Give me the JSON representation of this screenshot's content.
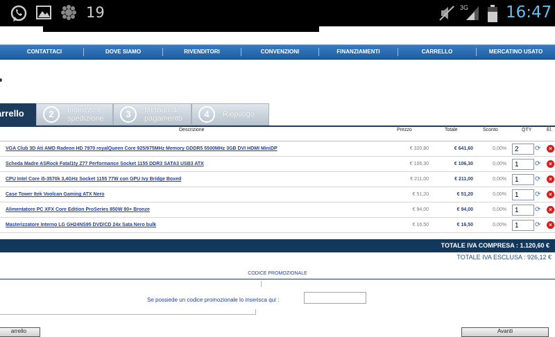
{
  "status_bar": {
    "notification_count": "19",
    "network": "3G",
    "time": "16:47",
    "icons": [
      "whatsapp-icon",
      "gallery-icon",
      "settings-icon",
      "mute-icon",
      "signal-icon",
      "battery-icon"
    ]
  },
  "nav": {
    "items": [
      "CONTATTACI",
      "DOVE SIAMO",
      "RIVENDITORI",
      "CONVENZIONI",
      "FINANZIAMENTI",
      "CARRELLO",
      "MERCATINO USATO"
    ]
  },
  "steps": [
    {
      "num": "",
      "label": "arrello"
    },
    {
      "num": "2",
      "label": "Indirizzo e spedizione"
    },
    {
      "num": "3",
      "label": "Metodo di pagamento"
    },
    {
      "num": "4",
      "label": "Riepilogo"
    }
  ],
  "cart": {
    "headers": {
      "description": "Descrizione",
      "price": "Prezzo",
      "total": "Totale",
      "discount": "Sconto",
      "qty": "QTY",
      "delete": "El."
    },
    "rows": [
      {
        "desc": "VGA Club 3D Ati AMD Radeon HD 7970 royalQueen Core 925/975MHz Memory GDDR5 5500MHz 3GB DVI HDMI MiniDP",
        "price": "€ 320,80",
        "total": "€ 641,60",
        "discount": "0,00%",
        "qty": "2"
      },
      {
        "desc": "Scheda Madre ASRock Fatal1ty Z77 Performance Socket 1155 DDR3 SATA3 USB3 ATX",
        "price": "€ 106,30",
        "total": "€ 106,30",
        "discount": "0,00%",
        "qty": "1"
      },
      {
        "desc": "CPU Intel Core i5-3570k 3,4GHz Socket 1155 77W con GPU Ivy Bridge Boxed",
        "price": "€ 211,00",
        "total": "€ 211,00",
        "discount": "0,00%",
        "qty": "1"
      },
      {
        "desc": "Case Tower Itek Voolcan Gaming ATX Nero",
        "price": "€ 51,20",
        "total": "€ 51,20",
        "discount": "0,00%",
        "qty": "1"
      },
      {
        "desc": "Alimentatore PC XFX Core Edition ProSeries 850W 80+ Bronze",
        "price": "€ 94,00",
        "total": "€ 94,00",
        "discount": "0,00%",
        "qty": "1"
      },
      {
        "desc": "Masterizzatore Interno LG GH24NS95 DVD/CD 24x Sata Nero bulk",
        "price": "€ 16,50",
        "total": "€ 16,50",
        "discount": "0,00%",
        "qty": "1"
      }
    ],
    "total_with_vat": "TOTALE IVA COMPRESA : 1.120,60 €",
    "total_without_vat": "TOTALE IVA ESCLUSA : 926,12 €"
  },
  "promo": {
    "heading": "CODICE PROMOZIONALE",
    "prompt": "Se possiede un codice promozionale lo inserisca qui :",
    "input_value": ""
  },
  "buttons": {
    "back_label": "arrello",
    "next_label": "Avanti"
  },
  "colors": {
    "nav": "#1e5da0",
    "dark": "#13385e",
    "link": "#1e3f9a",
    "delete": "#d01f1f",
    "time": "#5fc0ee"
  }
}
